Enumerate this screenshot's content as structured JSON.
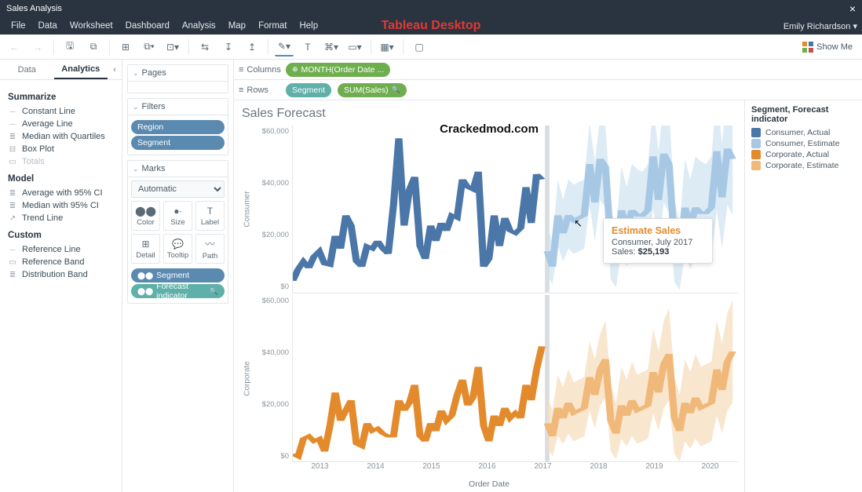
{
  "window": {
    "title": "Sales Analysis"
  },
  "menubar": {
    "items": [
      "File",
      "Data",
      "Worksheet",
      "Dashboard",
      "Analysis",
      "Map",
      "Format",
      "Help"
    ],
    "center_brand": "Tableau Desktop",
    "user": "Emily Richardson"
  },
  "toolbar": {
    "showme": "Show Me"
  },
  "sidebar": {
    "tabs": {
      "data": "Data",
      "analytics": "Analytics",
      "active": "analytics"
    },
    "summarize": {
      "header": "Summarize",
      "items": [
        "Constant Line",
        "Average Line",
        "Median with Quartiles",
        "Box Plot",
        "Totals"
      ]
    },
    "model": {
      "header": "Model",
      "items": [
        "Average with 95% CI",
        "Median with 95% CI",
        "Trend Line"
      ]
    },
    "custom": {
      "header": "Custom",
      "items": [
        "Reference Line",
        "Reference Band",
        "Distribution Band"
      ]
    }
  },
  "cards": {
    "pages": {
      "header": "Pages"
    },
    "filters": {
      "header": "Filters",
      "items": [
        "Region",
        "Segment"
      ]
    },
    "marks": {
      "header": "Marks",
      "dropdown": "Automatic",
      "cells": [
        "Color",
        "Size",
        "Label",
        "Detail",
        "Tooltip",
        "Path"
      ],
      "items": [
        "Segment",
        "Forecast indicator"
      ]
    }
  },
  "shelves": {
    "columns_label": "Columns",
    "rows_label": "Rows",
    "column_pills": [
      {
        "text": "MONTH(Order Date ...",
        "color": "green"
      }
    ],
    "row_pills": [
      {
        "text": "Segment",
        "color": "teal"
      },
      {
        "text": "SUM(Sales)",
        "color": "green",
        "search": true
      }
    ]
  },
  "viz": {
    "title": "Sales Forecast",
    "overlay_text": "Crackedmod.com",
    "x_label": "Order Date",
    "legend_header": "Segment, Forecast indicator",
    "legend_items": [
      {
        "label": "Consumer, Actual",
        "color": "#4a76a8"
      },
      {
        "label": "Consumer, Estimate",
        "color": "#a7c8e4"
      },
      {
        "label": "Corporate, Actual",
        "color": "#e38b2c"
      },
      {
        "label": "Corporate, Estimate",
        "color": "#f0b97a"
      }
    ],
    "tooltip": {
      "title": "Estimate Sales",
      "line1": "Consumer, July 2017",
      "line2_label": "Sales:",
      "line2_value": "$25,193"
    }
  },
  "chart_data": {
    "type": "line",
    "x_years": [
      2013,
      2014,
      2015,
      2016,
      2017,
      2018,
      2019,
      2020
    ],
    "y_ticks": [
      "$60,000",
      "$40,000",
      "$20,000",
      "$0"
    ],
    "row_labels": [
      "Consumer",
      "Corporate"
    ],
    "actual_end_month_index": 48,
    "forecast_end_month_index": 84,
    "series": [
      {
        "name": "Consumer, Actual",
        "role": "actual",
        "row": "Consumer",
        "values": [
          4500,
          9000,
          12000,
          9500,
          14000,
          16000,
          11000,
          10500,
          22000,
          17000,
          30000,
          26000,
          12000,
          10000,
          18000,
          17000,
          20000,
          17000,
          15000,
          34000,
          60000,
          26000,
          40000,
          45000,
          18000,
          13000,
          26000,
          20000,
          27000,
          24000,
          30000,
          29000,
          44000,
          41000,
          40000,
          47000,
          10000,
          13000,
          30000,
          18000,
          29000,
          24000,
          23000,
          25000,
          41000,
          27000,
          46000,
          44000
        ]
      },
      {
        "name": "Consumer, Estimate",
        "role": "estimate",
        "row": "Consumer",
        "values_start_index": 48,
        "values": [
          16000,
          10000,
          30000,
          23000,
          30000,
          28000,
          29000,
          30000,
          50000,
          35000,
          52000,
          49000,
          18000,
          12000,
          32000,
          25000,
          32000,
          30000,
          30000,
          32000,
          53000,
          36000,
          54000,
          50000,
          19000,
          13000,
          33000,
          26000,
          33000,
          31000,
          31000,
          33000,
          55000,
          37000,
          56000,
          52000
        ],
        "band_lo": [
          7000,
          3000,
          18000,
          12000,
          17000,
          15000,
          16000,
          17000,
          34000,
          20000,
          36000,
          33000,
          5000,
          2000,
          16000,
          10000,
          15000,
          13000,
          14000,
          15000,
          33000,
          18000,
          35000,
          31000,
          4000,
          1000,
          15000,
          9000,
          14000,
          12000,
          13000,
          14000,
          32000,
          17000,
          34000,
          30000
        ],
        "band_hi": [
          27000,
          19000,
          44000,
          36000,
          44000,
          42000,
          43000,
          44000,
          66000,
          51000,
          68000,
          65000,
          33000,
          24000,
          49000,
          41000,
          50000,
          48000,
          47000,
          50000,
          73000,
          55000,
          74000,
          71000,
          36000,
          27000,
          52000,
          44000,
          53000,
          51000,
          50000,
          53000,
          78000,
          58000,
          79000,
          75000
        ]
      },
      {
        "name": "Corporate, Actual",
        "role": "actual",
        "row": "Corporate",
        "values": [
          3000,
          2000,
          9000,
          10000,
          8000,
          9000,
          4000,
          14000,
          27000,
          16000,
          20000,
          24000,
          7000,
          6000,
          15000,
          12000,
          13000,
          11000,
          10000,
          10000,
          24000,
          20000,
          23000,
          30000,
          10000,
          8000,
          15000,
          12000,
          20000,
          16000,
          18000,
          26000,
          32000,
          22000,
          25000,
          37000,
          14000,
          8000,
          18000,
          14000,
          21000,
          17000,
          19000,
          17000,
          30000,
          24000,
          36000,
          45000
        ]
      },
      {
        "name": "Corporate, Estimate",
        "role": "estimate",
        "row": "Corporate",
        "values_start_index": 48,
        "values": [
          15000,
          10000,
          21000,
          17000,
          23000,
          19000,
          20000,
          21000,
          33000,
          26000,
          36000,
          40000,
          16000,
          11000,
          22000,
          18000,
          24000,
          20000,
          21000,
          22000,
          35000,
          27000,
          38000,
          42000,
          17000,
          12000,
          23000,
          19000,
          25000,
          21000,
          22000,
          23000,
          36000,
          28000,
          39000,
          43000
        ],
        "band_lo": [
          6000,
          2000,
          10000,
          7000,
          11000,
          8000,
          9000,
          10000,
          20000,
          13000,
          22000,
          25000,
          4000,
          1000,
          9000,
          6000,
          10000,
          7000,
          8000,
          9000,
          19000,
          12000,
          21000,
          24000,
          3000,
          0,
          8000,
          5000,
          9000,
          6000,
          7000,
          8000,
          18000,
          11000,
          20000,
          23000
        ],
        "band_hi": [
          26000,
          20000,
          34000,
          29000,
          36000,
          31000,
          32000,
          33000,
          47000,
          40000,
          50000,
          55000,
          30000,
          23000,
          37000,
          32000,
          39000,
          34000,
          35000,
          36000,
          52000,
          43000,
          55000,
          60000,
          33000,
          26000,
          40000,
          35000,
          42000,
          37000,
          38000,
          39000,
          55000,
          46000,
          58000,
          63000
        ]
      }
    ],
    "ylim": [
      0,
      65000
    ]
  }
}
